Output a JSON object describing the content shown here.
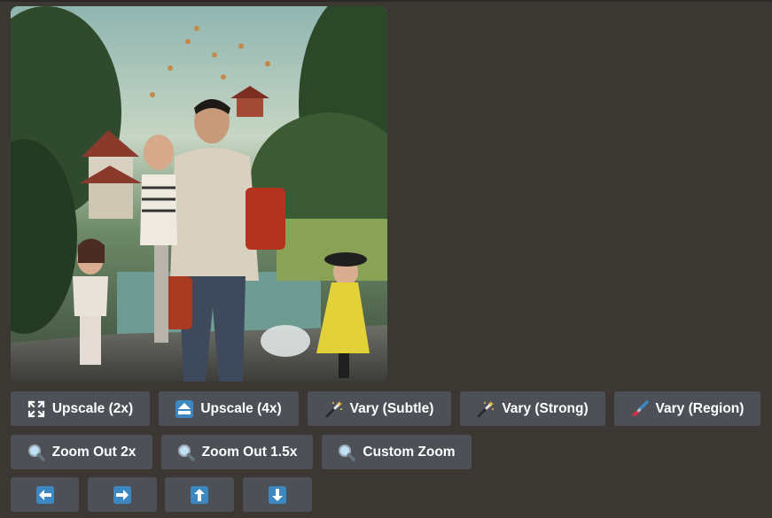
{
  "image": {
    "alt_icon": "generated-image"
  },
  "rows": {
    "upscale_vary": [
      {
        "label": "Upscale (2x)",
        "icon": "expand-icon"
      },
      {
        "label": "Upscale (4x)",
        "icon": "upload-arrow-icon"
      },
      {
        "label": "Vary (Subtle)",
        "icon": "magic-wand-icon"
      },
      {
        "label": "Vary (Strong)",
        "icon": "magic-wand-icon"
      },
      {
        "label": "Vary (Region)",
        "icon": "paintbrush-icon"
      }
    ],
    "zoom": [
      {
        "label": "Zoom Out 2x",
        "icon": "magnifier-icon"
      },
      {
        "label": "Zoom Out 1.5x",
        "icon": "magnifier-icon"
      },
      {
        "label": "Custom Zoom",
        "icon": "magnifier-icon"
      }
    ],
    "pan": [
      {
        "icon": "arrow-left-icon"
      },
      {
        "icon": "arrow-right-icon"
      },
      {
        "icon": "arrow-up-icon"
      },
      {
        "icon": "arrow-down-icon"
      }
    ]
  },
  "colors": {
    "background": "#3b3834",
    "button": "#4e5058",
    "icon_blue": "#3b88c3"
  }
}
